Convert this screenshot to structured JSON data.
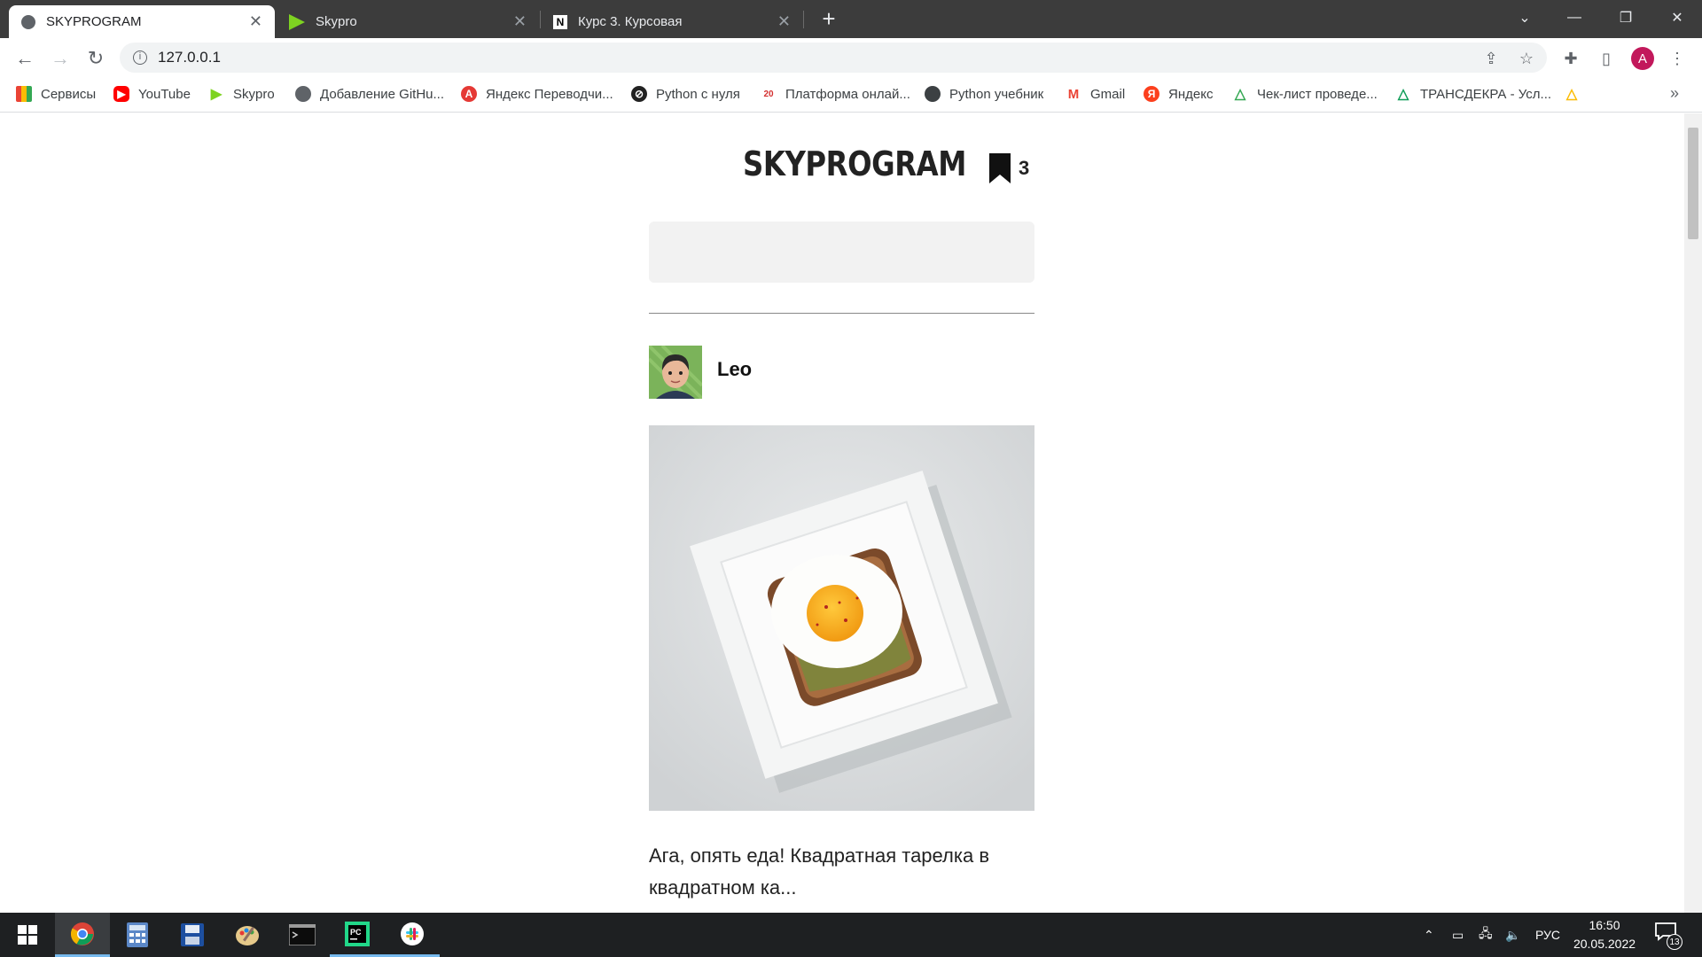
{
  "browser": {
    "tabs": [
      {
        "title": "SKYPROGRAM",
        "icon": "globe-icon"
      },
      {
        "title": "Skypro",
        "icon": "skypro-icon"
      },
      {
        "title": "Курс 3. Курсовая",
        "icon": "notion-icon"
      }
    ],
    "new_tab": "+",
    "address": "127.0.0.1",
    "profile_initial": "A",
    "bookmarks": [
      {
        "label": "Сервисы",
        "icon": "apps-grid-icon"
      },
      {
        "label": "YouTube",
        "icon": "youtube-icon"
      },
      {
        "label": "Skypro",
        "icon": "skypro-icon"
      },
      {
        "label": "Добавление GitHu...",
        "icon": "globe-icon"
      },
      {
        "label": "Яндекс Переводчи...",
        "icon": "translate-icon"
      },
      {
        "label": "Python с нуля",
        "icon": "python-icon"
      },
      {
        "label": "Платформа онлай...",
        "icon": "platform-2035-icon"
      },
      {
        "label": "Python учебник",
        "icon": "globe-icon"
      },
      {
        "label": "Gmail",
        "icon": "gmail-icon"
      },
      {
        "label": "Яндекс",
        "icon": "yandex-icon"
      },
      {
        "label": "Чек-лист проведе...",
        "icon": "google-drive-icon"
      },
      {
        "label": "ТРАНСДЕКРА - Усл...",
        "icon": "google-drive-icon"
      }
    ],
    "more_bookmarks": "»"
  },
  "site": {
    "logo": "SKYPROGRAM",
    "bookmarks_count": "3",
    "search_placeholder": "",
    "post": {
      "author": "Leo",
      "text": "Ага, опять еда! Квадратная тарелка в квадратном ка..."
    }
  },
  "taskbar": {
    "language": "РУС",
    "time": "16:50",
    "date": "20.05.2022",
    "notifications": "13"
  }
}
